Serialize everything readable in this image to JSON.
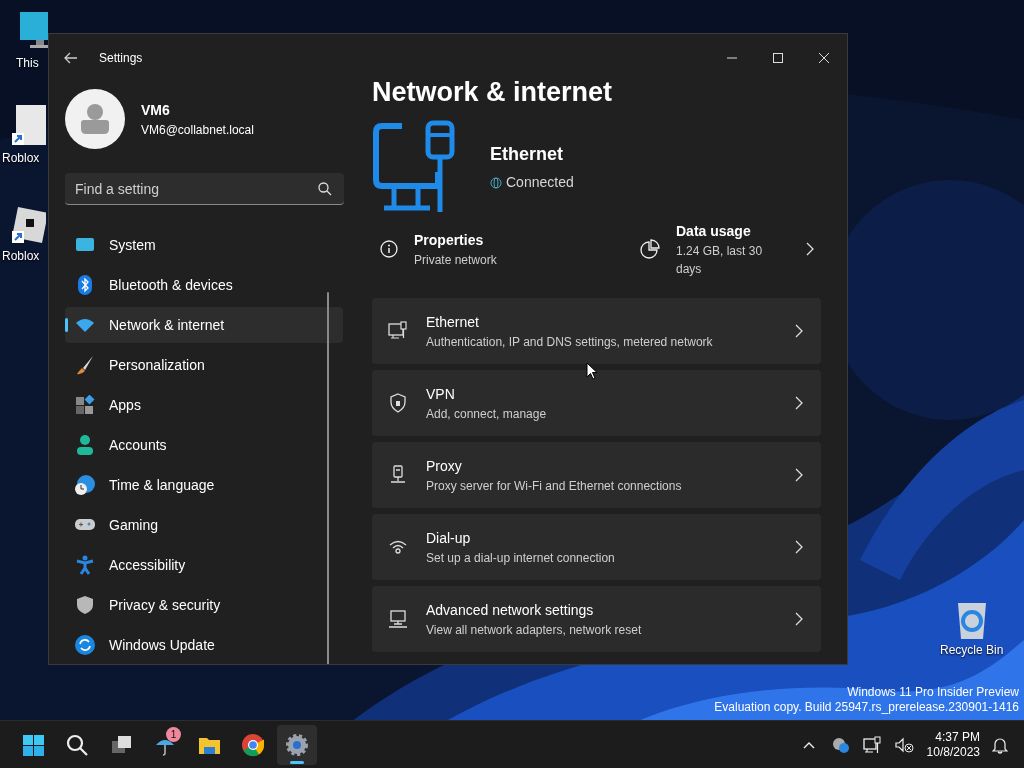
{
  "desktop_icons": [
    {
      "kind": "monitor",
      "label": "This"
    },
    {
      "kind": "document",
      "label": "Roblox"
    },
    {
      "kind": "roblox",
      "label": "Roblox"
    },
    {
      "kind": "recycle",
      "label": "Recycle Bin"
    }
  ],
  "window": {
    "title": "Settings",
    "user": {
      "name": "VM6",
      "email": "VM6@collabnet.local"
    },
    "search": {
      "placeholder": "Find a setting"
    },
    "nav": [
      {
        "kind": "system",
        "label": "System",
        "selected": false
      },
      {
        "kind": "bluetooth",
        "label": "Bluetooth & devices",
        "selected": false
      },
      {
        "kind": "network",
        "label": "Network & internet",
        "selected": true
      },
      {
        "kind": "brush",
        "label": "Personalization",
        "selected": false
      },
      {
        "kind": "apps",
        "label": "Apps",
        "selected": false
      },
      {
        "kind": "accounts",
        "label": "Accounts",
        "selected": false
      },
      {
        "kind": "time",
        "label": "Time & language",
        "selected": false
      },
      {
        "kind": "gaming",
        "label": "Gaming",
        "selected": false
      },
      {
        "kind": "accessibility",
        "label": "Accessibility",
        "selected": false
      },
      {
        "kind": "privacy",
        "label": "Privacy & security",
        "selected": false
      },
      {
        "kind": "update",
        "label": "Windows Update",
        "selected": false
      }
    ],
    "page_title": "Network & internet",
    "connection": {
      "name": "Ethernet",
      "status": "Connected"
    },
    "properties": {
      "title": "Properties",
      "subtitle": "Private network"
    },
    "data_usage": {
      "title": "Data usage",
      "subtitle": "1.24 GB, last 30 days"
    },
    "cards": [
      {
        "kind": "ethernet",
        "title": "Ethernet",
        "subtitle": "Authentication, IP and DNS settings, metered network"
      },
      {
        "kind": "vpn",
        "title": "VPN",
        "subtitle": "Add, connect, manage"
      },
      {
        "kind": "proxy",
        "title": "Proxy",
        "subtitle": "Proxy server for Wi-Fi and Ethernet connections"
      },
      {
        "kind": "dialup",
        "title": "Dial-up",
        "subtitle": "Set up a dial-up internet connection"
      },
      {
        "kind": "advanced",
        "title": "Advanced network settings",
        "subtitle": "View all network adapters, network reset"
      }
    ]
  },
  "desktop_notice": [
    "Windows 11 Pro Insider Preview",
    "Evaluation copy. Build 25947.rs_prerelease.230901-1416"
  ],
  "taskbar": {
    "apps": [
      {
        "kind": "start",
        "active": false
      },
      {
        "kind": "search",
        "active": false
      },
      {
        "kind": "taskview",
        "active": false
      },
      {
        "kind": "weather",
        "active": false,
        "badge": "1"
      },
      {
        "kind": "explorer",
        "active": false
      },
      {
        "kind": "chrome",
        "active": false
      },
      {
        "kind": "settings",
        "active": true
      }
    ],
    "time": "4:37 PM",
    "date": "10/8/2023"
  }
}
